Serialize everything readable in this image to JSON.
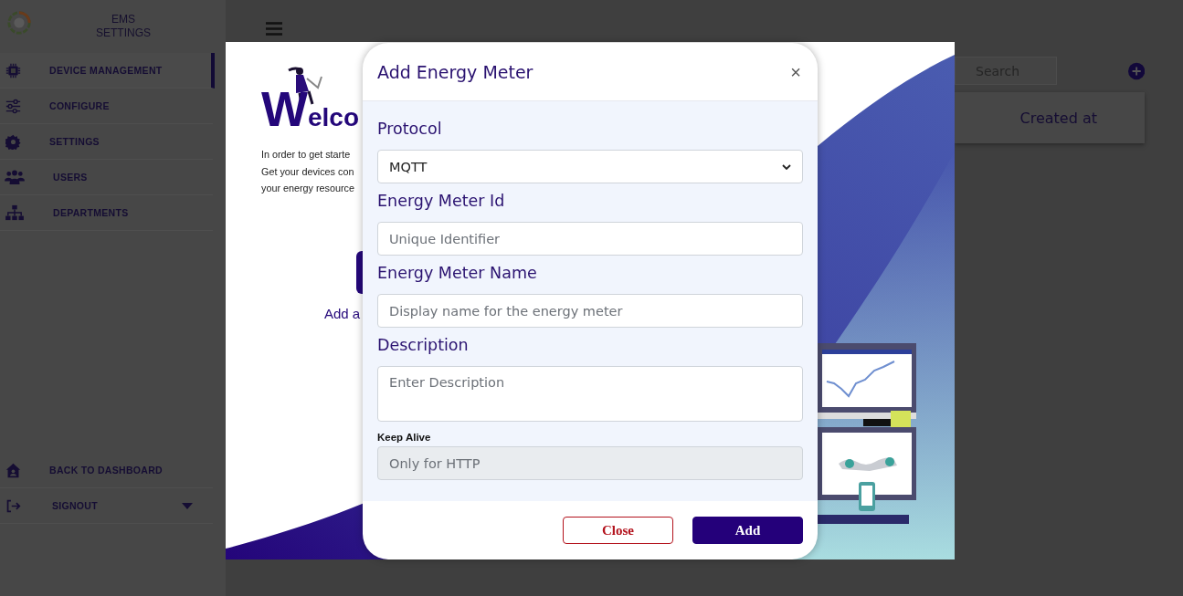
{
  "sidebar": {
    "title": "EMS SETTINGS",
    "items": [
      {
        "label": "DEVICE MANAGEMENT",
        "selected": true
      },
      {
        "label": "CONFIGURE",
        "selected": false
      },
      {
        "label": "SETTINGS",
        "selected": false
      },
      {
        "label": "USERS",
        "selected": false
      },
      {
        "label": "DEPARTMENTS",
        "selected": false
      }
    ],
    "bottom_items": [
      {
        "label": "BACK TO DASHBOARD"
      },
      {
        "label": "SIGNOUT"
      }
    ]
  },
  "main": {
    "search": {
      "placeholder": "Search"
    },
    "table": {
      "columns": [
        "Created at"
      ]
    }
  },
  "welcome": {
    "heading": "Welco",
    "intro_lines": [
      "In order to get starte",
      "Get your devices con",
      "your energy resource"
    ],
    "action_text": "Add a"
  },
  "modal": {
    "title": "Add Energy Meter",
    "close": "×",
    "fields": [
      {
        "kind": "select",
        "label": "Protocol",
        "value": "MQTT",
        "disabled": false
      },
      {
        "kind": "input",
        "label": "Energy Meter Id",
        "placeholder": "Unique Identifier",
        "disabled": false
      },
      {
        "kind": "input",
        "label": "Energy Meter Name",
        "placeholder": "Display name for the energy meter",
        "disabled": false
      },
      {
        "kind": "textarea",
        "label": "Description",
        "placeholder": "Enter Description",
        "disabled": false
      },
      {
        "kind": "input",
        "label": "Keep Alive",
        "placeholder": "Only for HTTP",
        "disabled": true
      }
    ],
    "buttons": [
      {
        "label": "Close",
        "kind": "secondary"
      },
      {
        "label": "Add",
        "kind": "primary"
      }
    ]
  }
}
